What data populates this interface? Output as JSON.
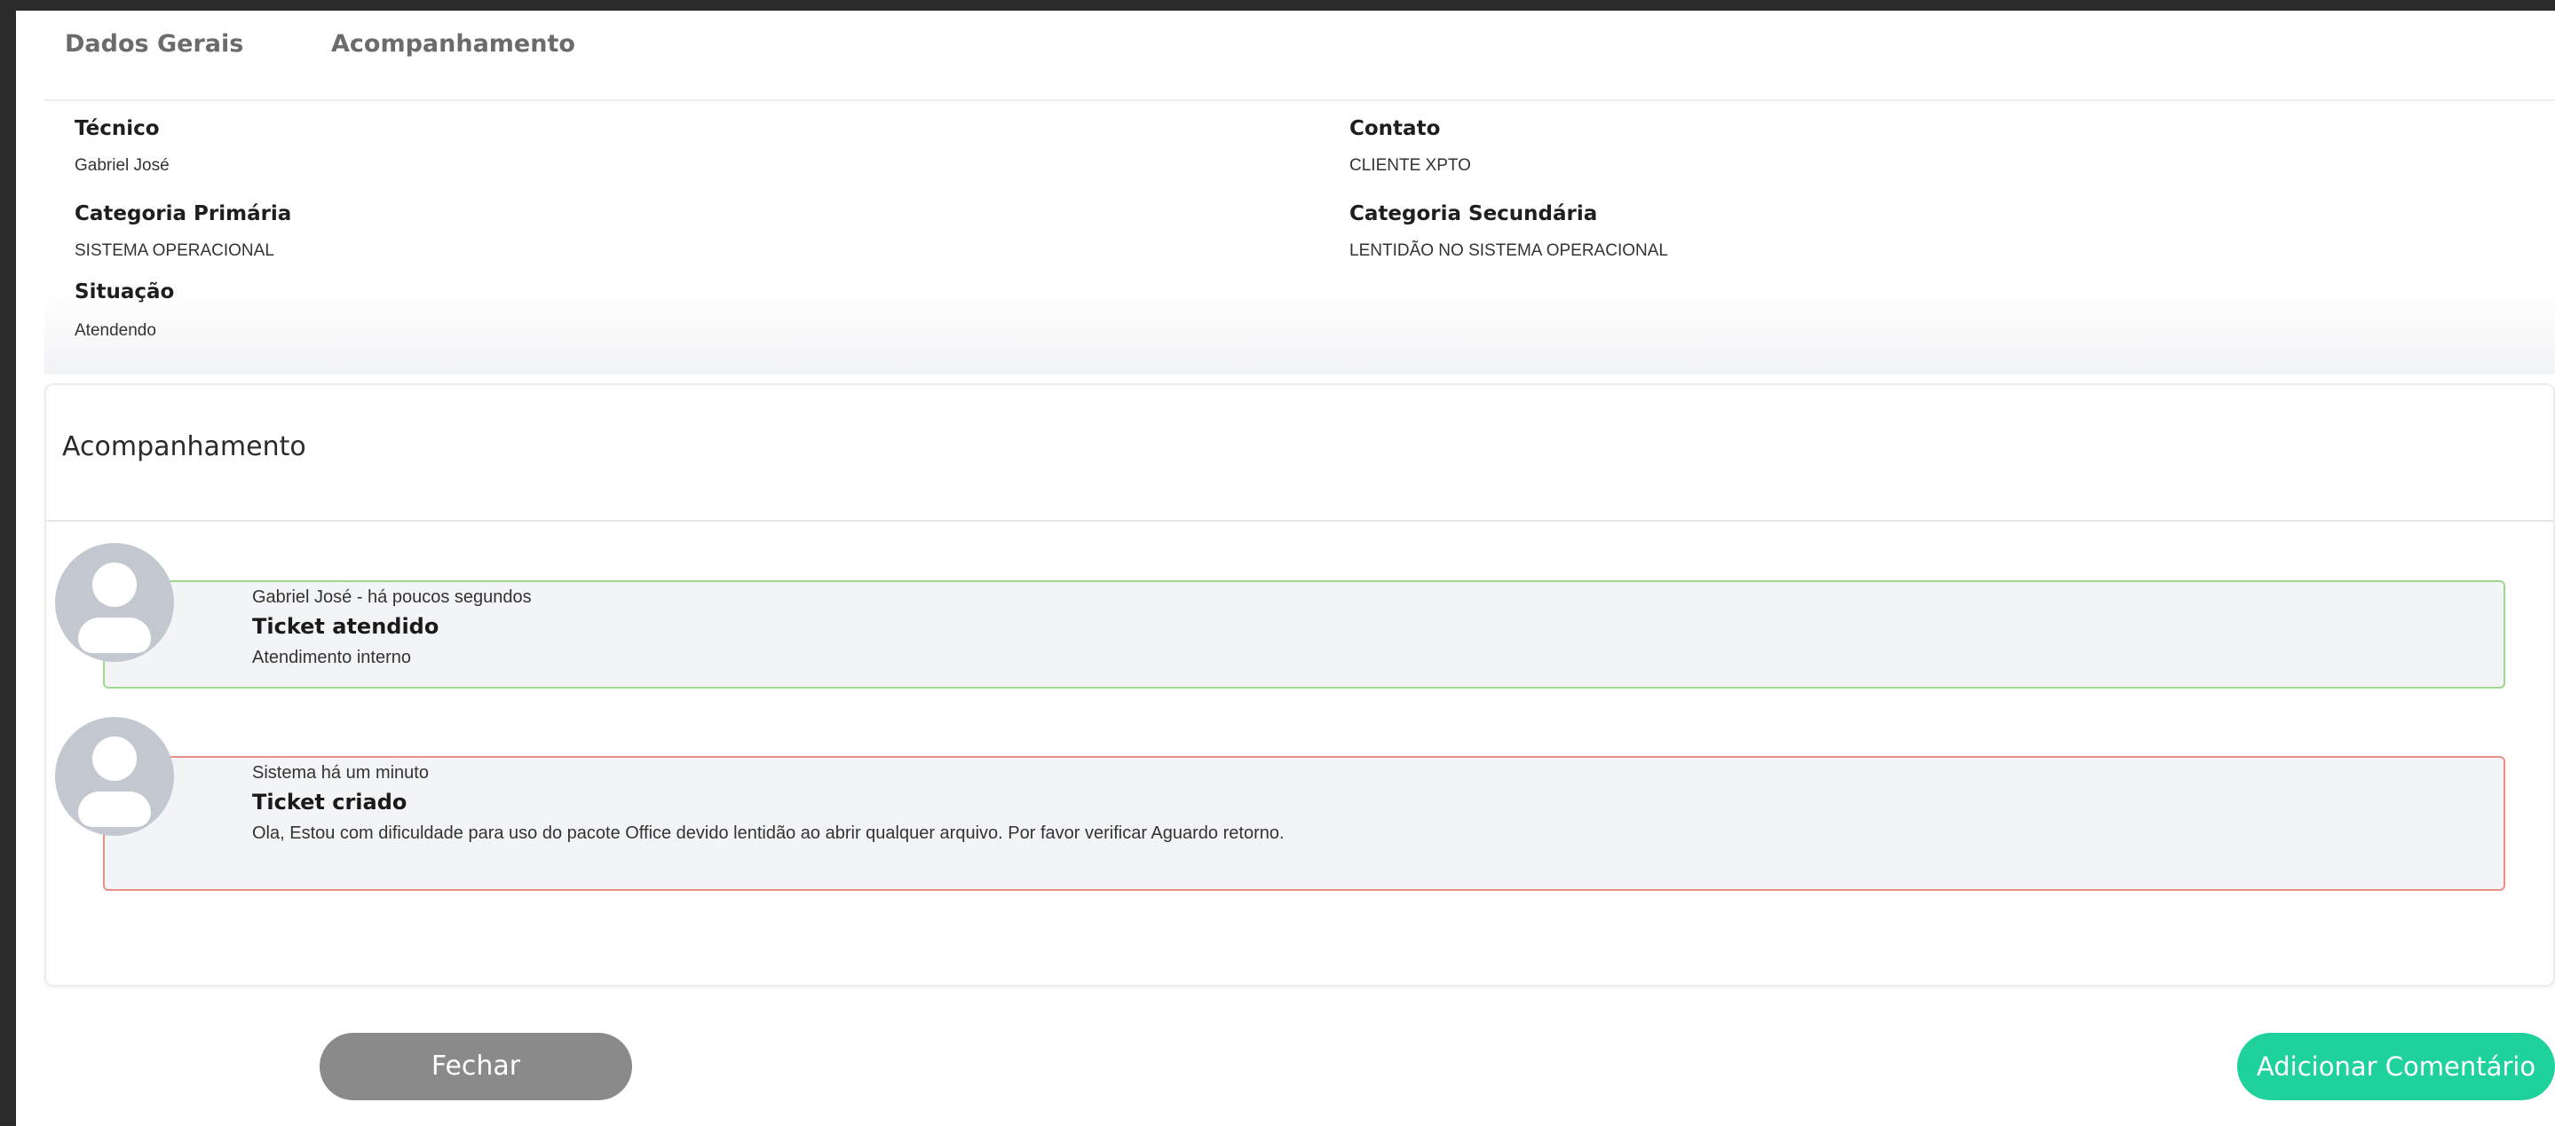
{
  "tabs": [
    {
      "label": "Dados Gerais"
    },
    {
      "label": "Acompanhamento"
    }
  ],
  "info": {
    "tecnico_label": "Técnico",
    "tecnico_value": "Gabriel José",
    "contato_label": "Contato",
    "contato_value": "CLIENTE XPTO",
    "cat_primaria_label": "Categoria Primária",
    "cat_primaria_value": "SISTEMA OPERACIONAL",
    "cat_secundaria_label": "Categoria Secundária",
    "cat_secundaria_value": "LENTIDÃO NO SISTEMA OPERACIONAL",
    "situacao_label": "Situação",
    "situacao_value": "Atendendo"
  },
  "followup": {
    "title": "Acompanhamento",
    "comments": [
      {
        "meta": "Gabriel José - há poucos segundos",
        "title": "Ticket atendido",
        "body": "Atendimento interno",
        "border_color": "#9ed88e"
      },
      {
        "meta": "Sistema há um minuto",
        "title": "Ticket criado",
        "body": "Ola, Estou com dificuldade para uso do pacote Office devido lentidão ao abrir qualquer arquivo. Por favor verificar Aguardo retorno.",
        "border_color": "#ea8f86"
      }
    ]
  },
  "actions": {
    "close_label": "Fechar",
    "add_comment_label": "Adicionar Comentário"
  },
  "colors": {
    "accent": "#1fd19b",
    "close_button": "#8a8a8a",
    "avatar": "#c3c8d0"
  },
  "icons": [
    "user-avatar-icon"
  ]
}
